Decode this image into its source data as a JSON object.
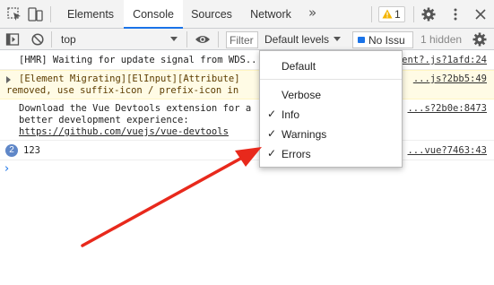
{
  "tabbar": {
    "tabs": [
      {
        "label": "Elements"
      },
      {
        "label": "Console"
      },
      {
        "label": "Sources"
      },
      {
        "label": "Network"
      }
    ],
    "more_label": "»",
    "warning_count": "1",
    "icons": [
      "inspect-icon",
      "device-toggle-icon",
      "more-tabs-icon",
      "warning-icon",
      "gear-icon",
      "kebab-menu-icon"
    ]
  },
  "toolbar": {
    "context_value": "top",
    "filter_placeholder": "Filter",
    "levels_label": "Default levels",
    "issues_label": "No Issu",
    "hidden_label": "1 hidden",
    "icons": [
      "sidebar-toggle-icon",
      "clear-console-icon",
      "eye-icon",
      "gear-icon"
    ]
  },
  "messages": [
    {
      "text": "[HMR] Waiting for update signal from WDS...",
      "source": "client?.js?1afd:24"
    },
    {
      "text_line1": "[Element Migrating][ElInput][Attribute]",
      "text_line2": "removed, use suffix-icon / prefix-icon in",
      "source": "...js?2bb5:49"
    },
    {
      "text_line1": "Download the Vue Devtools extension for a",
      "text_line2": "better development experience:",
      "link": "https://github.com/vuejs/vue-devtools",
      "source": "...s?2b0e:8473"
    },
    {
      "repeat_count": "2",
      "text": "123",
      "source": "...vue?7463:43"
    }
  ],
  "prompt_glyph": "›",
  "levels_menu": {
    "items": [
      {
        "label": "Default",
        "checked": false
      },
      {
        "label": "Verbose",
        "checked": false
      },
      {
        "label": "Info",
        "checked": true
      },
      {
        "label": "Warnings",
        "checked": true
      },
      {
        "label": "Errors",
        "checked": true
      }
    ],
    "check_glyph": "✓"
  },
  "colors": {
    "accent": "#1a73e8",
    "warning_bg": "#fffbe5",
    "annotation_arrow": "#e8291c"
  }
}
